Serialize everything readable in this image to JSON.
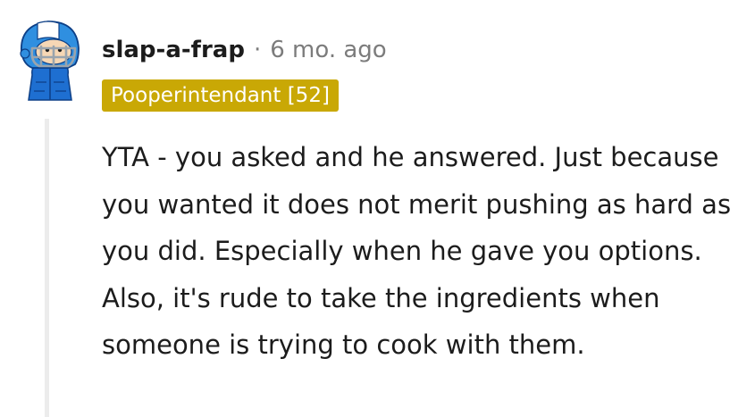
{
  "comment": {
    "username": "slap-a-frap",
    "separator": "·",
    "timestamp": "6 mo. ago",
    "flair": "Pooperintendant [52]",
    "flair_color": "#c9a805",
    "body": "YTA - you asked and he answered. Just because you wanted it does not merit pushing as hard as you did. Especially when he gave you options. Also, it's rude to take the ingredients when someone is trying to cook with them.",
    "avatar": {
      "icon": "football-helmet-avatar-icon",
      "helmet_color": "#2f8fe0",
      "jacket_color": "#1e6fd1",
      "bg_color": "#e9e9e9"
    }
  }
}
